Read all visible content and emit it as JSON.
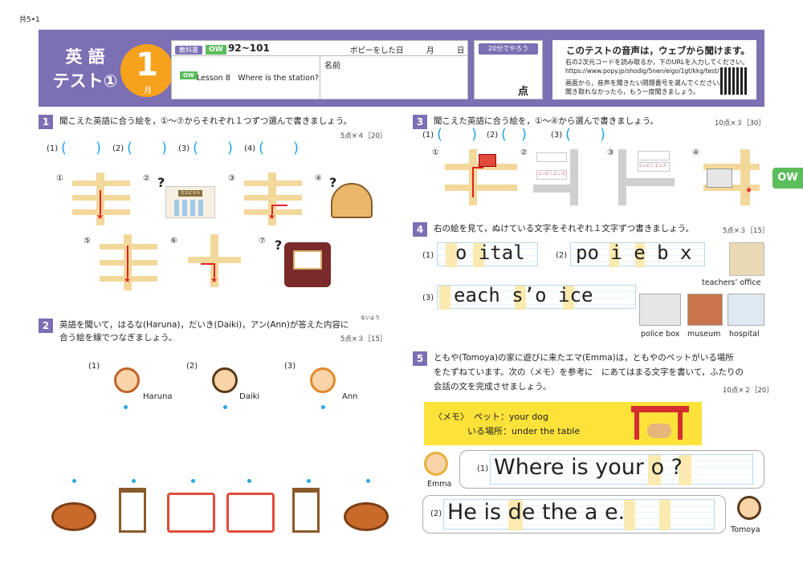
{
  "corner_code": "共5•1",
  "header": {
    "title_line1": "英 語",
    "title_line2": "テスト①",
    "month_number": "1",
    "month_label": "月",
    "textbook_tag": "教科書",
    "ow_tag": "OW",
    "pages": "92~101",
    "date_label": "ポピーをした日　　　月　　　日",
    "lesson_tag": "OW",
    "lesson": "Lesson 8　Where is the station?",
    "name_label": "名前",
    "time_tag": "20分でやろう",
    "score_label": "点",
    "audio_title": "このテストの音声は，ウェブから聞けます。",
    "audio_line1": "右の2次元コードを読み取るか，下のURLを入力してください。",
    "audio_url": "https://www.popy.jp/shodig/5nen/eigo/1gt/kkg/test/",
    "audio_line2": "画面から，音声を聞きたい問題番号を選んでください。",
    "audio_line3": "聞き取れなかったら，もう一度聞きましょう。"
  },
  "ow_tab": "OW",
  "q1": {
    "num": "1",
    "text": "聞こえた英語に合う絵を，①～⑦からそれぞれ１つずつ選んで書きましょう。",
    "points": "5点×４［20］",
    "answers": [
      "(1)",
      "(2)",
      "(3)",
      "(4)"
    ],
    "labels": [
      "①",
      "②",
      "③",
      "④",
      "⑤",
      "⑥",
      "⑦"
    ],
    "hospital_sign": "ホスピタル"
  },
  "q2": {
    "num": "2",
    "text_line1": "英語を聞いて，はるな(Haruna)，だいき(Daiki)，アン(Ann)が答えた内容に",
    "ruby": "ないよう",
    "text_line2": "合う絵を線でつなぎましょう。",
    "points": "5点×３［15］",
    "people": [
      {
        "num": "(1)",
        "name": "Haruna"
      },
      {
        "num": "(2)",
        "name": "Daiki"
      },
      {
        "num": "(3)",
        "name": "Ann"
      }
    ]
  },
  "q3": {
    "num": "3",
    "text": "聞こえた英語に合う絵を，①～④から選んで書きましょう。",
    "points": "10点×３［30］",
    "answers": [
      "(1)",
      "(2)",
      "(3)"
    ],
    "labels": [
      "①",
      "②",
      "③",
      "④"
    ],
    "sign": "コンビニエンス"
  },
  "q4": {
    "num": "4",
    "text": "右の絵を見て，ぬけている文字をそれぞれ１文字ずつ書きましょう。",
    "points": "5点×３［15］",
    "items": [
      {
        "num": "(1)",
        "word": "o  ital"
      },
      {
        "num": "(2)",
        "word": "po i e b x"
      },
      {
        "num": "(3)",
        "word": "each  s’o  ice"
      }
    ],
    "captions": [
      "teachers’ office",
      "police box",
      "museum",
      "hospital"
    ]
  },
  "q5": {
    "num": "5",
    "text_line1": "ともや(Tomoya)の家に遊びに来たエマ(Emma)は，ともやのペットがいる場所",
    "text_line2": "をたずねています。次の〈メモ〉を参考に　にあてはまる文字を書いて，ふたりの",
    "text_line3": "会話の文を完成させましょう。",
    "points": "10点×２［20］",
    "memo_title": "〈メモ〉",
    "memo_line1": "ペット：your dog",
    "memo_line2": "いる場所：under the table",
    "emma": "Emma",
    "tomoya": "Tomoya",
    "s1_num": "(1)",
    "s1": "Where is your  o ?",
    "s2_num": "(2)",
    "s2": "He is  de the  a  e."
  }
}
